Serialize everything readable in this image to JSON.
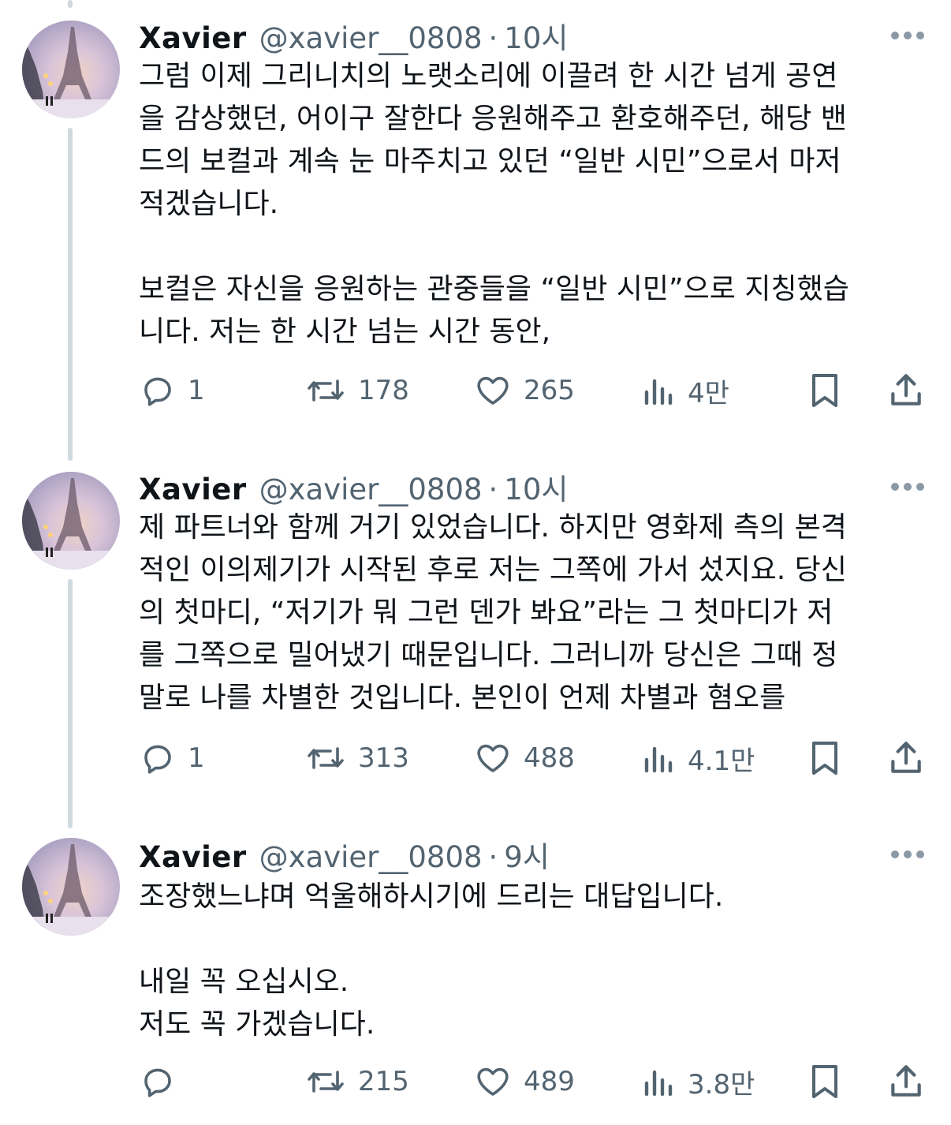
{
  "author": {
    "name": "Xavier",
    "handle": "@xavier__0808",
    "separator": "·"
  },
  "tweets": [
    {
      "time": "10시",
      "text": "그럼 이제 그리니치의 노랫소리에 이끌려 한 시간 넘게 공연\n을 감상했던, 어이구 잘한다 응원해주고 환호해주던, 해당 밴\n드의 보컬과 계속 눈 마주치고 있던 “일반 시민”으로서 마저\n적겠습니다.\n\n보컬은 자신을 응원하는 관중들을 “일반 시민”으로 지칭했습\n니다. 저는 한 시간 넘는 시간 동안,",
      "replies": "1",
      "retweets": "178",
      "likes": "265",
      "views": "4만"
    },
    {
      "time": "10시",
      "text": "제 파트너와 함께 거기 있었습니다. 하지만 영화제 측의 본격\n적인 이의제기가 시작된 후로 저는 그쪽에 가서 섰지요. 당신\n의 첫마디, “저기가 뭐 그런 덴가 봐요”라는 그 첫마디가 저\n를 그쪽으로 밀어냈기 때문입니다. 그러니까 당신은 그때 정\n말로 나를 차별한 것입니다. 본인이 언제 차별과 혐오를",
      "replies": "1",
      "retweets": "313",
      "likes": "488",
      "views": "4.1만"
    },
    {
      "time": "9시",
      "text": "조장했느냐며 억울해하시기에 드리는 대답입니다.\n\n내일 꼭 오십시오.\n저도 꼭 가겠습니다.",
      "replies": "",
      "retweets": "215",
      "likes": "489",
      "views": "3.8만"
    }
  ],
  "icons": {
    "reply": "reply-icon",
    "retweet": "retweet-icon",
    "like": "heart-icon",
    "views": "views-icon",
    "bookmark": "bookmark-icon",
    "share": "share-icon",
    "more": "more-icon"
  },
  "colors": {
    "text": "#0f1419",
    "secondary": "#536471",
    "thread_line": "#cfd9de"
  }
}
